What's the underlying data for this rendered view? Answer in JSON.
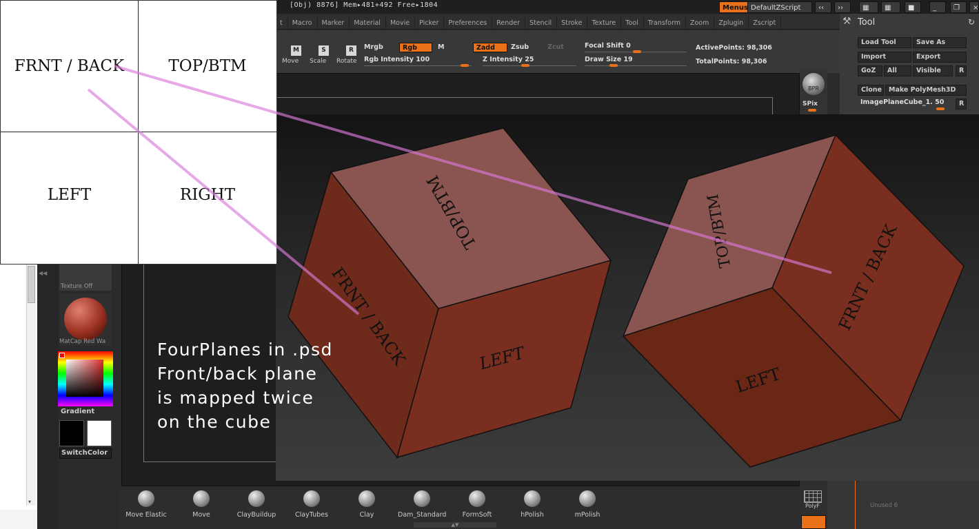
{
  "topbar": {
    "status": "[Obj) 8876] Mem▸481+492 Free▸1804",
    "menus_label": "Menus",
    "script_label": "DefaultZScript"
  },
  "menu_items": [
    "t",
    "Macro",
    "Marker",
    "Material",
    "Movie",
    "Picker",
    "Preferences",
    "Render",
    "Stencil",
    "Stroke",
    "Texture",
    "Tool",
    "Transform",
    "Zoom",
    "Zplugin",
    "Zscript"
  ],
  "toolbar": {
    "move": {
      "key": "M",
      "label": "Move"
    },
    "scale": {
      "key": "S",
      "label": "Scale"
    },
    "rotate": {
      "key": "R",
      "label": "Rotate"
    },
    "mrgb": "Mrgb",
    "rgb": "Rgb",
    "m": "M",
    "zadd": "Zadd",
    "zsub": "Zsub",
    "zcut": "Zcut",
    "rgb_intensity": "Rgb Intensity 100",
    "z_intensity": "Z Intensity 25",
    "focal_shift": "Focal Shift 0",
    "draw_size": "Draw Size 19",
    "active_points": "ActivePoints: 98,306",
    "total_points": "TotalPoints: 98,306"
  },
  "tool_panel": {
    "title": "Tool",
    "load_tool": "Load Tool",
    "save_as": "Save As",
    "import": "Import",
    "export": "Export",
    "goz": "GoZ",
    "all": "All",
    "visible": "Visible",
    "r": "R",
    "clone": "Clone",
    "make_polymesh": "Make PolyMesh3D",
    "image_plane": "ImagePlaneCube_1. 50",
    "unused": "Unused 6"
  },
  "side": {
    "bpr": "BPR",
    "spix": "SPix",
    "polyf": "PolyF"
  },
  "palette": {
    "texture": "Texture Off",
    "matcap": "MatCap Red Wa",
    "gradient": "Gradient",
    "switch_color": "SwitchColor"
  },
  "brushes": [
    "Move Elastic",
    "Move",
    "ClayBuildup",
    "ClayTubes",
    "Clay",
    "Dam_Standard",
    "FormSoft",
    "hPolish",
    "mPolish"
  ],
  "planes": {
    "front_back": "FRNT / BACK",
    "top_btm": "TOP/BTM",
    "left": "LEFT",
    "right": "RIGHT"
  },
  "cube_labels": {
    "top_btm": "TOP/BTM",
    "front_back": "FRNT / BACK",
    "left": "LEFT"
  },
  "caption": [
    "FourPlanes in .psd",
    "Front/back plane",
    "is mapped twice",
    "on the cube"
  ],
  "colors": {
    "accent": "#e8711a",
    "cube_top": "#8a5450",
    "cube_side": "#7a2e1f",
    "cube_face": "#6a2716",
    "guide_line": "#d87ad8"
  }
}
